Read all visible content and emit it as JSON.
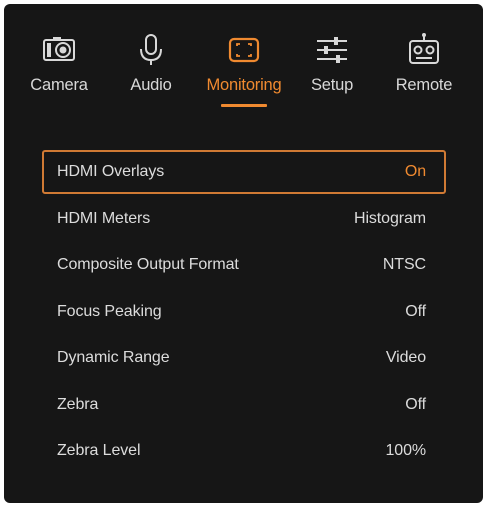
{
  "tabs": [
    {
      "id": "camera",
      "label": "Camera",
      "icon": "camera-icon"
    },
    {
      "id": "audio",
      "label": "Audio",
      "icon": "microphone-icon"
    },
    {
      "id": "monitoring",
      "label": "Monitoring",
      "icon": "monitor-frame-icon"
    },
    {
      "id": "setup",
      "label": "Setup",
      "icon": "sliders-icon"
    },
    {
      "id": "remote",
      "label": "Remote",
      "icon": "robot-icon"
    }
  ],
  "active_tab": "monitoring",
  "colors": {
    "background": "#161616",
    "accent": "#f08a30",
    "text": "#dcdcdc"
  },
  "menu": {
    "items": [
      {
        "label": "HDMI Overlays",
        "value": "On",
        "selected": true
      },
      {
        "label": "HDMI Meters",
        "value": "Histogram",
        "selected": false
      },
      {
        "label": "Composite Output Format",
        "value": "NTSC",
        "selected": false
      },
      {
        "label": "Focus Peaking",
        "value": "Off",
        "selected": false
      },
      {
        "label": "Dynamic Range",
        "value": "Video",
        "selected": false
      },
      {
        "label": "Zebra",
        "value": "Off",
        "selected": false
      },
      {
        "label": "Zebra Level",
        "value": "100%",
        "selected": false
      }
    ]
  }
}
